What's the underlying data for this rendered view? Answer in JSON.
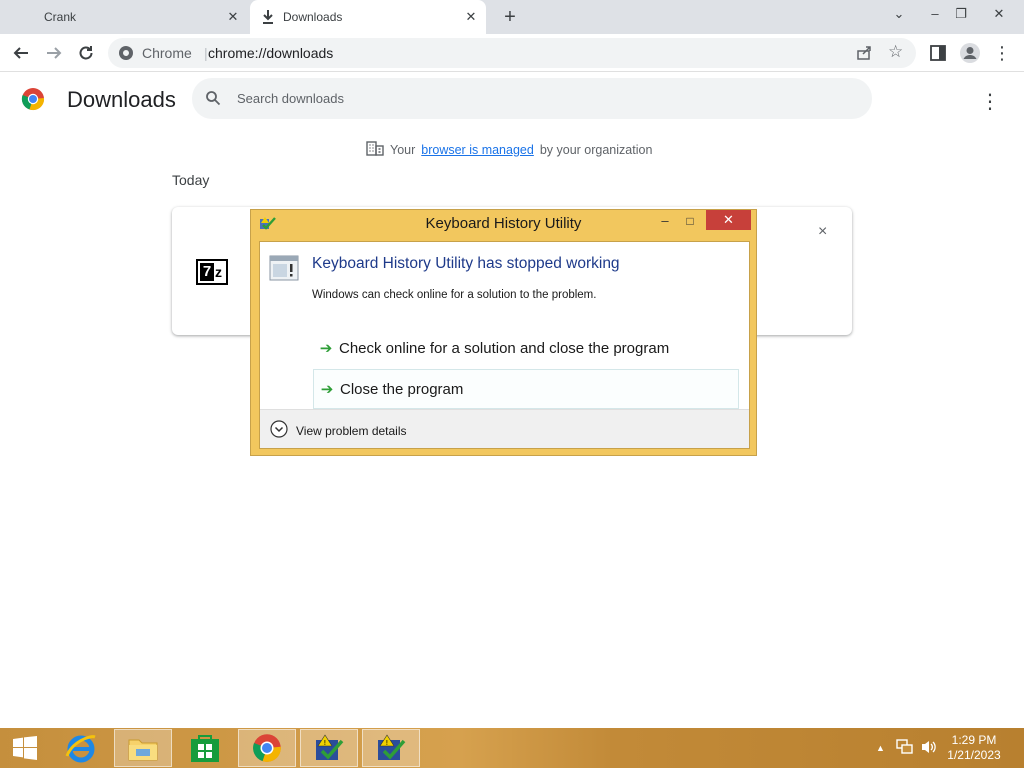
{
  "browser": {
    "tabs": [
      {
        "title": "Crank",
        "active": false
      },
      {
        "title": "Downloads",
        "active": true
      }
    ],
    "omnibox": {
      "site": "Chrome",
      "url": "chrome://downloads"
    }
  },
  "page": {
    "title": "Downloads",
    "search_placeholder": "Search downloads",
    "managed": {
      "prefix": "Your",
      "link": "browser is managed",
      "suffix": "by your organization"
    },
    "section_label": "Today",
    "download_item": {
      "icon": "7z",
      "close": "×"
    }
  },
  "dialog": {
    "title": "Keyboard History Utility",
    "heading": "Keyboard History Utility has stopped working",
    "subtext": "Windows can check online for a solution to the problem.",
    "options": [
      {
        "label": "Check online for a solution and close the program"
      },
      {
        "label": "Close the program"
      }
    ],
    "details_label": "View problem details"
  },
  "taskbar": {
    "apps": [
      "windows-start",
      "internet-explorer",
      "file-explorer",
      "windows-store",
      "chrome",
      "keyboard-history-utility",
      "keyboard-history-utility"
    ],
    "clock": {
      "time": "1:29 PM",
      "date": "1/21/2023"
    }
  },
  "colors": {
    "accent": "#1a73e8",
    "dialog_frame": "#f2c75e",
    "dialog_close": "#c7403a",
    "heading": "#1e3a8a"
  }
}
